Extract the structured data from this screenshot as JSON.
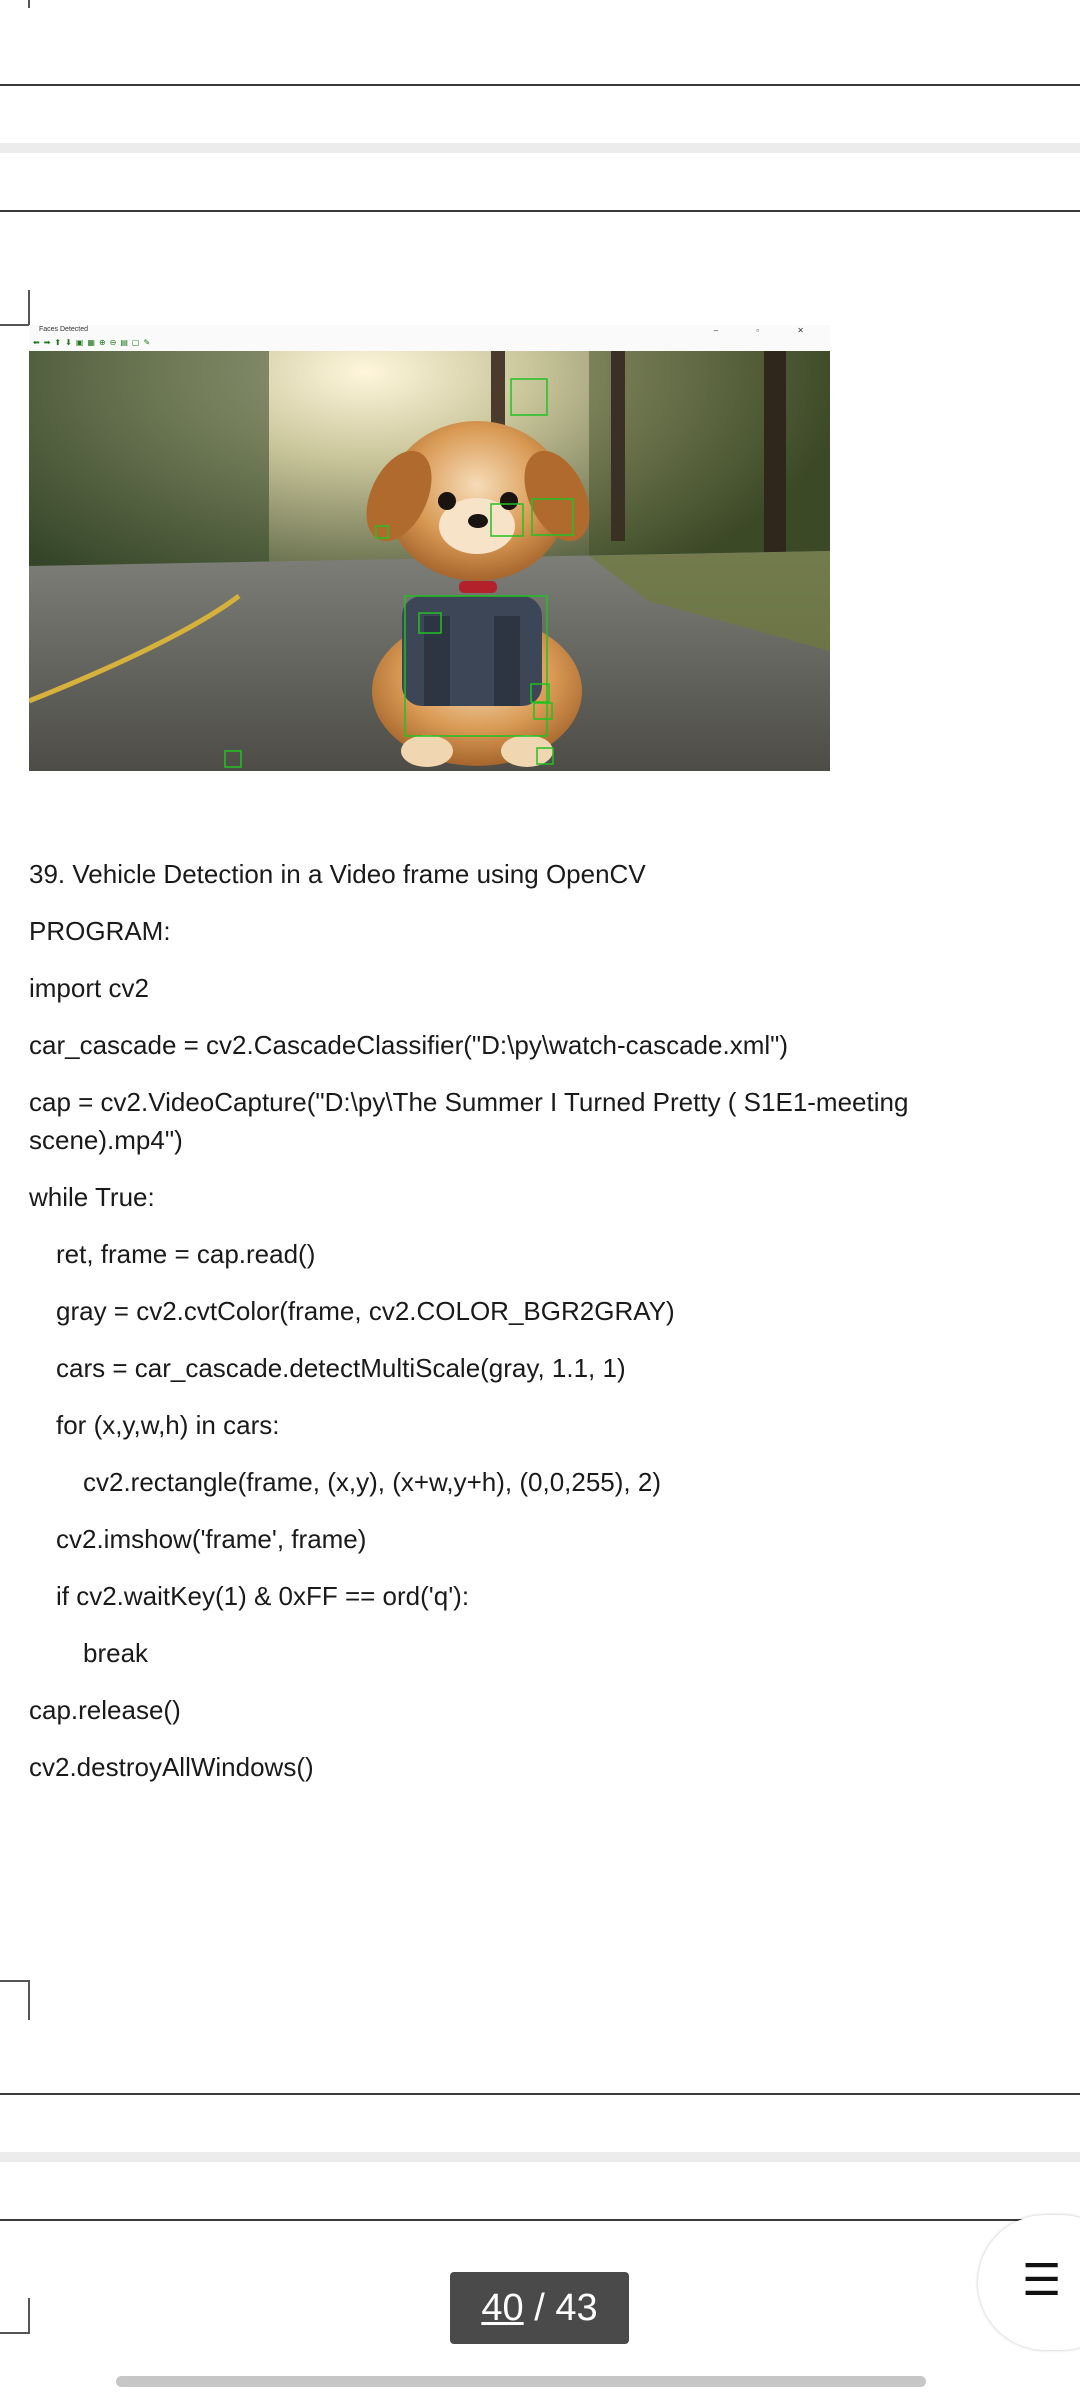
{
  "figure": {
    "window_title": "Faces Detected",
    "window_controls": "–  ▫  ✕",
    "toolbar_icons": [
      "arrow-left-icon",
      "arrow-right-icon",
      "arrow-up-icon",
      "arrow-down-icon",
      "image-icon",
      "grid-icon",
      "zoom-in-icon",
      "zoom-out-icon",
      "save-icon",
      "copy-icon",
      "edit-icon"
    ],
    "photo_description_icon": "puppy-photo"
  },
  "document": {
    "heading": "39. Vehicle Detection in a Video frame using OpenCV",
    "program_label": "PROGRAM:",
    "code": [
      {
        "text": "import cv2",
        "indent": 0
      },
      {
        "text": "car_cascade = cv2.CascadeClassifier(\"D:\\py\\watch-cascade.xml\")",
        "indent": 0
      },
      {
        "text": "cap = cv2.VideoCapture(\"D:\\py\\The Summer I Turned Pretty ( S1E1-meeting scene).mp4\")",
        "indent": 0
      },
      {
        "text": "while True:",
        "indent": 0
      },
      {
        "text": "ret, frame = cap.read()",
        "indent": 1
      },
      {
        "text": "gray = cv2.cvtColor(frame, cv2.COLOR_BGR2GRAY)",
        "indent": 1
      },
      {
        "text": "cars = car_cascade.detectMultiScale(gray, 1.1, 1)",
        "indent": 1
      },
      {
        "text": "for (x,y,w,h) in cars:",
        "indent": 1
      },
      {
        "text": "cv2.rectangle(frame, (x,y), (x+w,y+h), (0,0,255), 2)",
        "indent": 2
      },
      {
        "text": "cv2.imshow('frame', frame)",
        "indent": 1
      },
      {
        "text": "if cv2.waitKey(1) & 0xFF == ord('q'):",
        "indent": 1
      },
      {
        "text": "break",
        "indent": 2
      },
      {
        "text": "cap.release()",
        "indent": 0
      },
      {
        "text": "cv2.destroyAllWindows()",
        "indent": 0
      }
    ]
  },
  "pager": {
    "current": "40",
    "separator": " / ",
    "total": "43"
  },
  "menu": {
    "icon": "☰",
    "icon_name": "hamburger-menu-icon"
  },
  "colors": {
    "pager_bg": "#4a4a4a",
    "detect_box": "#22c122",
    "divider": "#3a3a3a"
  }
}
